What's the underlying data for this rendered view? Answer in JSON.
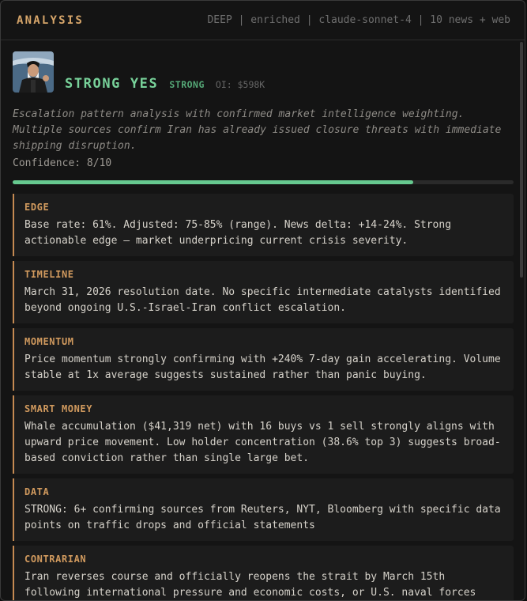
{
  "header": {
    "title": "ANALYSIS",
    "meta": "DEEP | enriched | claude-sonnet-4 | 10 news + web"
  },
  "verdict": {
    "label": "STRONG YES",
    "strength": "STRONG",
    "open_interest": "OI: $598K"
  },
  "summary": "Escalation pattern analysis with confirmed market intelligence weighting. Multiple sources confirm Iran has already issued closure threats with immediate shipping disruption.",
  "confidence": {
    "label": "Confidence: 8/10",
    "value": 8,
    "max": 10
  },
  "sections": [
    {
      "title": "EDGE",
      "body": "Base rate: 61%. Adjusted: 75-85% (range). News delta: +14-24%. Strong actionable edge — market underpricing current crisis severity."
    },
    {
      "title": "TIMELINE",
      "body": "March 31, 2026 resolution date. No specific intermediate catalysts identified beyond ongoing U.S.-Israel-Iran conflict escalation."
    },
    {
      "title": "MOMENTUM",
      "body": "Price momentum strongly confirming with +240% 7-day gain accelerating. Volume stable at 1x average suggests sustained rather than panic buying."
    },
    {
      "title": "SMART MONEY",
      "body": "Whale accumulation ($41,319 net) with 16 buys vs 1 sell strongly aligns with upward price movement. Low holder concentration (38.6% top 3) suggests broad-based conviction rather than single large bet."
    },
    {
      "title": "DATA",
      "body": "STRONG: 6+ confirming sources from Reuters, NYT, Bloomberg with specific data points on traffic drops and official statements"
    },
    {
      "title": "CONTRARIAN",
      "body": "Iran reverses course and officially reopens the strait by March 15th following international pressure and economic costs, or U.S. naval forces"
    }
  ],
  "colors": {
    "accent": "#d6a56a",
    "verdict": "#78d29a",
    "progress": "#66c98f"
  }
}
